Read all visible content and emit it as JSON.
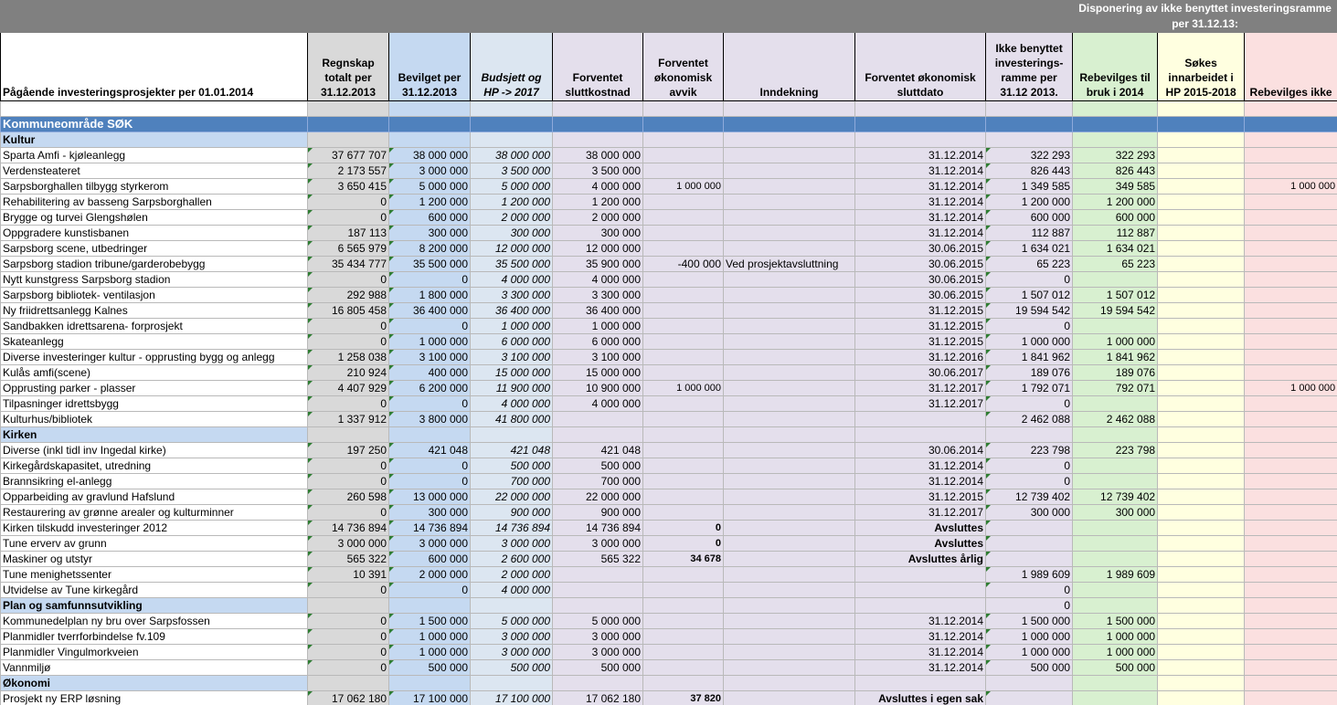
{
  "header": {
    "disposition": "Disponering  av ikke benyttet investeringsramme per 31.12.13:",
    "col_project": "Pågående investeringsprosjekter per 01.01.2014",
    "col_regnskap": "Regnskap totalt per 31.12.2013",
    "col_bevilget": "Bevilget per 31.12.2013",
    "col_budsjett": "Budsjett og HP -> 2017",
    "col_forv_slutt": "Forventet sluttkostnad",
    "col_forv_avvik": "Forventet økonomisk avvik",
    "col_inndekning": "Inndekning",
    "col_sluttdato": "Forventet økonomisk sluttdato",
    "col_ikke_benyttet": "Ikke benyttet investerings-ramme per 31.12 2013.",
    "col_rebevilges": "Rebevilges til bruk i 2014",
    "col_sokes": "Søkes innarbeidet i HP 2015-2018",
    "col_rebevilges_ikke": "Rebevilges ikke"
  },
  "area": "Kommuneområde SØK",
  "rows": [
    {
      "type": "section",
      "name": "Kultur"
    },
    {
      "type": "row",
      "name": "Sparta Amfi - kjøleanlegg",
      "reg": "37 677 707",
      "bev": "38 000 000",
      "bud": "38 000 000",
      "fs": "38 000 000",
      "fa": "",
      "inn": "",
      "dato": "31.12.2014",
      "ikke": "322 293",
      "reb": "322 293",
      "sok": "",
      "rik": ""
    },
    {
      "type": "row",
      "name": "Verdensteateret",
      "reg": "2 173 557",
      "bev": "3 000 000",
      "bud": "3 500 000",
      "fs": "3 500 000",
      "fa": "",
      "inn": "",
      "dato": "31.12.2014",
      "ikke": "826 443",
      "reb": "826 443",
      "sok": "",
      "rik": ""
    },
    {
      "type": "row",
      "name": "Sarpsborghallen tilbygg styrkerom",
      "reg": "3 650 415",
      "bev": "5 000 000",
      "bud": "5 000 000",
      "fs": "4 000 000",
      "fa": "1 000 000",
      "inn": "",
      "dato": "31.12.2014",
      "ikke": "1 349 585",
      "reb": "349 585",
      "sok": "",
      "rik": "1 000 000"
    },
    {
      "type": "row",
      "name": "Rehabilitering av basseng Sarpsborghallen",
      "reg": "0",
      "bev": "1 200 000",
      "bud": "1 200 000",
      "fs": "1 200 000",
      "fa": "",
      "inn": "",
      "dato": "31.12.2014",
      "ikke": "1 200 000",
      "reb": "1 200 000",
      "sok": "",
      "rik": ""
    },
    {
      "type": "row",
      "name": "Brygge og turvei Glengshølen",
      "reg": "0",
      "bev": "600 000",
      "bud": "2 000 000",
      "fs": "2 000 000",
      "fa": "",
      "inn": "",
      "dato": "31.12.2014",
      "ikke": "600 000",
      "reb": "600 000",
      "sok": "",
      "rik": ""
    },
    {
      "type": "row",
      "name": "Oppgradere kunstisbanen",
      "reg": "187 113",
      "bev": "300 000",
      "bud": "300 000",
      "fs": "300 000",
      "fa": "",
      "inn": "",
      "dato": "31.12.2014",
      "ikke": "112 887",
      "reb": "112 887",
      "sok": "",
      "rik": ""
    },
    {
      "type": "row",
      "name": "Sarpsborg scene, utbedringer",
      "reg": "6 565 979",
      "bev": "8 200 000",
      "bud": "12 000 000",
      "fs": "12 000 000",
      "fa": "",
      "inn": "",
      "dato": "30.06.2015",
      "ikke": "1 634 021",
      "reb": "1 634 021",
      "sok": "",
      "rik": ""
    },
    {
      "type": "row",
      "name": "Sarpsborg stadion tribune/garderobebygg",
      "reg": "35 434 777",
      "bev": "35 500 000",
      "bud": "35 500 000",
      "fs": "35 900 000",
      "fa": "-400 000",
      "inn": "Ved prosjektavsluttning",
      "dato": "30.06.2015",
      "ikke": "65 223",
      "reb": "65 223",
      "sok": "",
      "rik": ""
    },
    {
      "type": "row",
      "name": "Nytt kunstgress Sarpsborg stadion",
      "reg": "0",
      "bev": "0",
      "bud": "4 000 000",
      "fs": "4 000 000",
      "fa": "",
      "inn": "",
      "dato": "30.06.2015",
      "ikke": "0",
      "reb": "",
      "sok": "",
      "rik": ""
    },
    {
      "type": "row",
      "name": "Sarpsborg bibliotek- ventilasjon",
      "reg": "292 988",
      "bev": "1 800 000",
      "bud": "3 300 000",
      "fs": "3 300 000",
      "fa": "",
      "inn": "",
      "dato": "30.06.2015",
      "ikke": "1 507 012",
      "reb": "1 507 012",
      "sok": "",
      "rik": ""
    },
    {
      "type": "row",
      "name": "Ny friidrettsanlegg Kalnes",
      "reg": "16 805 458",
      "bev": "36 400 000",
      "bud": "36 400 000",
      "fs": "36 400 000",
      "fa": "",
      "inn": "",
      "dato": "31.12.2015",
      "ikke": "19 594 542",
      "reb": "19 594 542",
      "sok": "",
      "rik": ""
    },
    {
      "type": "row",
      "name": "Sandbakken idrettsarena- forprosjekt",
      "reg": "0",
      "bev": "0",
      "bud": "1 000 000",
      "fs": "1 000 000",
      "fa": "",
      "inn": "",
      "dato": "31.12.2015",
      "ikke": "0",
      "reb": "",
      "sok": "",
      "rik": ""
    },
    {
      "type": "row",
      "name": "Skateanlegg",
      "reg": "0",
      "bev": "1 000 000",
      "bud": "6 000 000",
      "fs": "6 000 000",
      "fa": "",
      "inn": "",
      "dato": "31.12.2015",
      "ikke": "1 000 000",
      "reb": "1 000 000",
      "sok": "",
      "rik": ""
    },
    {
      "type": "row",
      "name": "Diverse investeringer kultur - opprusting bygg og anlegg",
      "reg": "1 258 038",
      "bev": "3 100 000",
      "bud": "3 100 000",
      "fs": "3 100 000",
      "fa": "",
      "inn": "",
      "dato": "31.12.2016",
      "ikke": "1 841 962",
      "reb": "1 841 962",
      "sok": "",
      "rik": ""
    },
    {
      "type": "row",
      "name": "Kulås amfi(scene)",
      "reg": "210 924",
      "bev": "400 000",
      "bud": "15 000 000",
      "fs": "15 000 000",
      "fa": "",
      "inn": "",
      "dato": "30.06.2017",
      "ikke": "189 076",
      "reb": "189 076",
      "sok": "",
      "rik": ""
    },
    {
      "type": "row",
      "name": "Opprusting parker - plasser",
      "reg": "4 407 929",
      "bev": "6 200 000",
      "bud": "11 900 000",
      "fs": "10 900 000",
      "fa": "1 000 000",
      "inn": "",
      "dato": "31.12.2017",
      "ikke": "1 792 071",
      "reb": "792 071",
      "sok": "",
      "rik": "1 000 000"
    },
    {
      "type": "row",
      "name": "Tilpasninger idrettsbygg",
      "reg": "0",
      "bev": "0",
      "bud": "4 000 000",
      "fs": "4 000 000",
      "fa": "",
      "inn": "",
      "dato": "31.12.2017",
      "ikke": "0",
      "reb": "",
      "sok": "",
      "rik": ""
    },
    {
      "type": "row",
      "name": "Kulturhus/bibliotek",
      "reg": "1 337 912",
      "bev": "3 800 000",
      "bud": "41 800 000",
      "fs": "",
      "fa": "",
      "inn": "",
      "dato": "",
      "ikke": "2 462 088",
      "reb": "2 462 088",
      "sok": "",
      "rik": ""
    },
    {
      "type": "section",
      "name": "Kirken"
    },
    {
      "type": "row",
      "name": "Diverse (inkl tidl inv Ingedal kirke)",
      "reg": "197 250",
      "bev": "421 048",
      "bud": "421 048",
      "fs": "421 048",
      "fa": "",
      "inn": "",
      "dato": "30.06.2014",
      "ikke": "223 798",
      "reb": "223 798",
      "sok": "",
      "rik": ""
    },
    {
      "type": "row",
      "name": "Kirkegårdskapasitet, utredning",
      "reg": "0",
      "bev": "0",
      "bud": "500 000",
      "fs": "500 000",
      "fa": "",
      "inn": "",
      "dato": "31.12.2014",
      "ikke": "0",
      "reb": "",
      "sok": "",
      "rik": ""
    },
    {
      "type": "row",
      "name": "Brannsikring el-anlegg",
      "reg": "0",
      "bev": "0",
      "bud": "700 000",
      "fs": "700 000",
      "fa": "",
      "inn": "",
      "dato": "31.12.2014",
      "ikke": "0",
      "reb": "",
      "sok": "",
      "rik": ""
    },
    {
      "type": "row",
      "name": "Opparbeiding av gravlund Hafslund",
      "reg": "260 598",
      "bev": "13 000 000",
      "bud": "22 000 000",
      "fs": "22 000 000",
      "fa": "",
      "inn": "",
      "dato": "31.12.2015",
      "ikke": "12 739 402",
      "reb": "12 739 402",
      "sok": "",
      "rik": ""
    },
    {
      "type": "row",
      "name": "Restaurering av grønne arealer og kulturminner",
      "reg": "0",
      "bev": "300 000",
      "bud": "900 000",
      "fs": "900 000",
      "fa": "",
      "inn": "",
      "dato": "31.12.2017",
      "ikke": "300 000",
      "reb": "300 000",
      "sok": "",
      "rik": ""
    },
    {
      "type": "row",
      "name": "Kirken tilskudd investeringer 2012",
      "reg": "14 736 894",
      "bev": "14 736 894",
      "bud": "14 736 894",
      "fs": "14 736 894",
      "fa": "0",
      "inn": "",
      "dato": "Avsluttes",
      "ikke": "",
      "reb": "",
      "sok": "",
      "rik": ""
    },
    {
      "type": "row",
      "name": "Tune erverv av grunn",
      "reg": "3 000 000",
      "bev": "3 000 000",
      "bud": "3 000 000",
      "fs": "3 000 000",
      "fa": "0",
      "inn": "",
      "dato": "Avsluttes",
      "ikke": "",
      "reb": "",
      "sok": "",
      "rik": ""
    },
    {
      "type": "row",
      "name": "Maskiner og utstyr",
      "reg": "565 322",
      "bev": "600 000",
      "bud": "2 600 000",
      "fs": "565 322",
      "fa": "34 678",
      "inn": "",
      "dato": "Avsluttes årlig",
      "ikke": "",
      "reb": "",
      "sok": "",
      "rik": ""
    },
    {
      "type": "row",
      "name": "Tune menighetssenter",
      "reg": "10 391",
      "bev": "2 000 000",
      "bud": "2 000 000",
      "fs": "",
      "fa": "",
      "inn": "",
      "dato": "",
      "ikke": "1 989 609",
      "reb": "1 989 609",
      "sok": "",
      "rik": ""
    },
    {
      "type": "row",
      "name": "Utvidelse av Tune kirkegård",
      "reg": "0",
      "bev": "0",
      "bud": "4 000 000",
      "fs": "",
      "fa": "",
      "inn": "",
      "dato": "",
      "ikke": "0",
      "reb": "",
      "sok": "",
      "rik": ""
    },
    {
      "type": "section",
      "name": "Plan og samfunnsutvikling",
      "ikke": "0"
    },
    {
      "type": "row",
      "name": "Kommunedelplan ny bru over Sarpsfossen",
      "reg": "0",
      "bev": "1 500 000",
      "bud": "5 000 000",
      "fs": "5 000 000",
      "fa": "",
      "inn": "",
      "dato": "31.12.2014",
      "ikke": "1 500 000",
      "reb": "1 500 000",
      "sok": "",
      "rik": ""
    },
    {
      "type": "row",
      "name": "Planmidler tverrforbindelse fv.109",
      "reg": "0",
      "bev": "1 000 000",
      "bud": "3 000 000",
      "fs": "3 000 000",
      "fa": "",
      "inn": "",
      "dato": "31.12.2014",
      "ikke": "1 000 000",
      "reb": "1 000 000",
      "sok": "",
      "rik": ""
    },
    {
      "type": "row",
      "name": "Planmidler Vingulmorkveien",
      "reg": "0",
      "bev": "1 000 000",
      "bud": "3 000 000",
      "fs": "3 000 000",
      "fa": "",
      "inn": "",
      "dato": "31.12.2014",
      "ikke": "1 000 000",
      "reb": "1 000 000",
      "sok": "",
      "rik": ""
    },
    {
      "type": "row",
      "name": "Vannmiljø",
      "reg": "0",
      "bev": "500 000",
      "bud": "500 000",
      "fs": "500 000",
      "fa": "",
      "inn": "",
      "dato": "31.12.2014",
      "ikke": "500 000",
      "reb": "500 000",
      "sok": "",
      "rik": ""
    },
    {
      "type": "section",
      "name": "Økonomi"
    },
    {
      "type": "row",
      "name": "Prosjekt ny ERP løsning",
      "reg": "17 062 180",
      "bev": "17 100 000",
      "bud": "17 100 000",
      "fs": "17 062 180",
      "fa": "37 820",
      "inn": "",
      "dato": "Avsluttes i egen sak",
      "ikke": "",
      "reb": "",
      "sok": "",
      "rik": ""
    }
  ]
}
